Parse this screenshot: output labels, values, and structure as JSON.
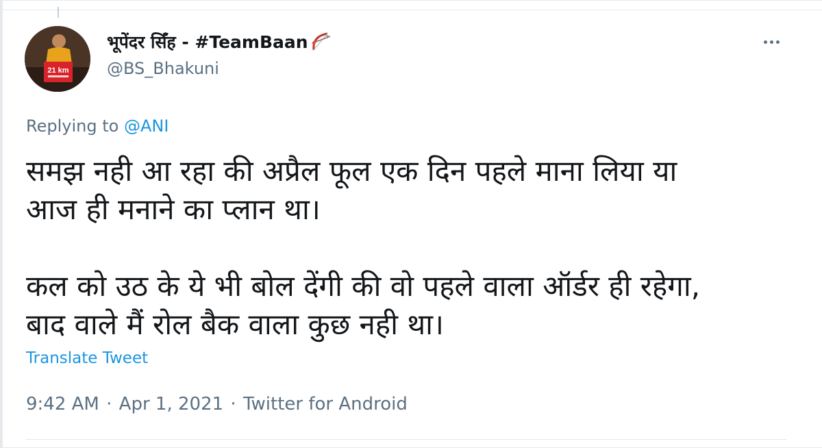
{
  "tweet": {
    "author": {
      "display_name": "भूपेंदर सिँह - #TeamBaan",
      "handle": "@BS_Bhakuni",
      "name_emoji": "bow-and-arrow-icon"
    },
    "replying_prefix": "Replying to",
    "replying_to": "@ANI",
    "text": "समझ नही आ रहा की अप्रैल फूल एक दिन पहले माना लिया या\nआज ही मनाने का प्लान था।\n\nकल को उठ के ये भी बोल देंगी की वो पहले वाला ऑर्डर ही रहेगा,\nबाद वाले मैं रोल बैक वाला कुछ नही था।",
    "translate_label": "Translate Tweet",
    "time": "9:42 AM",
    "separator": "·",
    "date": "Apr 1, 2021",
    "source": "Twitter for Android",
    "avatar_badge_text": "21 km",
    "colors": {
      "link": "#1b95e0",
      "secondary": "#5b7083",
      "primary": "#14171a"
    }
  }
}
